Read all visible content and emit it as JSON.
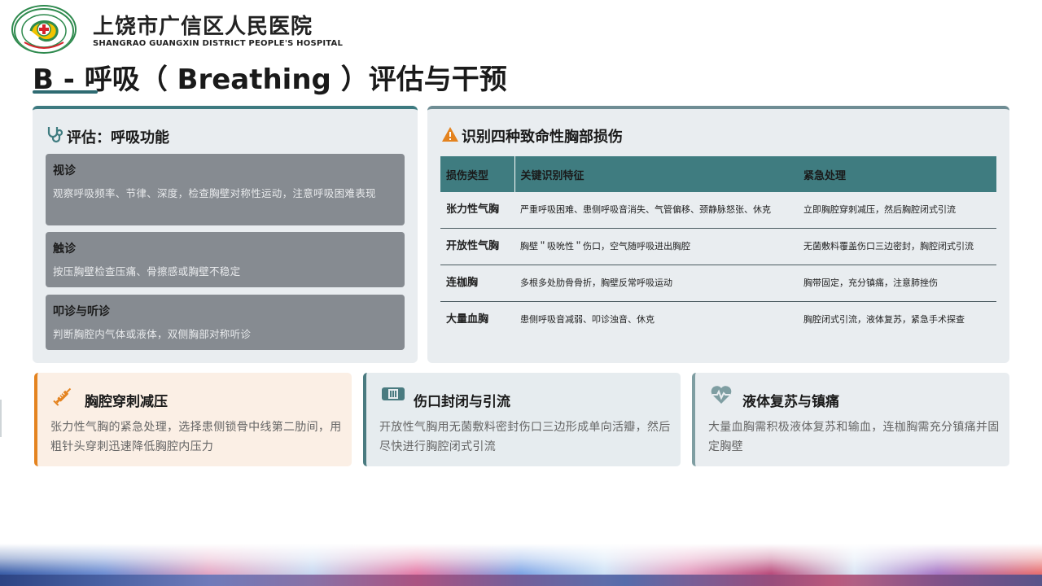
{
  "header": {
    "hospital_cn": "上饶市广信区人民医院",
    "hospital_en": "SHANGRAO GUANGXIN DISTRICT PEOPLE'S HOSPITAL",
    "logo_icon": "hospital-logo-icon"
  },
  "title": "B -  呼吸（  Breathing  ）评估与干预",
  "assessment": {
    "heading": "评估：呼吸功能",
    "icon": "stethoscope-icon",
    "items": [
      {
        "title": "视诊",
        "desc": "观察呼吸频率、节律、深度，检查胸壁对称性运动，注意呼吸困难表现"
      },
      {
        "title": "触诊",
        "desc": "按压胸壁检查压痛、骨擦感或胸壁不稳定"
      },
      {
        "title": "叩诊与听诊",
        "desc": "判断胸腔内气体或液体，双侧胸部对称听诊"
      }
    ]
  },
  "injuries": {
    "heading": "识别四种致命性胸部损伤",
    "icon": "warning-icon",
    "columns": [
      "损伤类型",
      "关键识别特征",
      "紧急处理"
    ],
    "rows": [
      {
        "type": "张力性气胸",
        "features": "严重呼吸困难、患侧呼吸音消失、气管偏移、颈静脉怒张、休克",
        "treatment": "立即胸腔穿刺减压，然后胸腔闭式引流"
      },
      {
        "type": "开放性气胸",
        "features": "胸壁＂吸吮性＂伤口，空气随呼吸进出胸腔",
        "treatment": "无菌敷料覆盖伤口三边密封，胸腔闭式引流"
      },
      {
        "type": "连枷胸",
        "features": "多根多处肋骨骨折，胸壁反常呼吸运动",
        "treatment": "胸带固定，充分镇痛，注意肺挫伤"
      },
      {
        "type": "大量血胸",
        "features": "患侧呼吸音减弱、叩诊浊音、休克",
        "treatment": "胸腔闭式引流，液体复苏，紧急手术探查"
      }
    ]
  },
  "interventions": [
    {
      "title": "胸腔穿刺减压",
      "icon": "syringe-icon",
      "desc": "张力性气胸的紧急处理，选择患侧锁骨中线第二肋间，用粗针头穿刺迅速降低胸腔内压力",
      "accent": "#e4831f"
    },
    {
      "title": "伤口封闭与引流",
      "icon": "bandage-icon",
      "desc": "开放性气胸用无菌敷料密封伤口三边形成单向活瓣，然后尽快进行胸腔闭式引流",
      "accent": "#4a7b80"
    },
    {
      "title": "液体复苏与镇痛",
      "icon": "heart-pulse-icon",
      "desc": "大量血胸需积极液体复苏和输血，连枷胸需充分镇痛并固定胸壁",
      "accent": "#7f9ea2"
    }
  ],
  "colors": {
    "teal": "#3f7c80",
    "orange": "#e4831f",
    "card_gray": "#868b91",
    "panel_bg": "#e9edf0"
  }
}
